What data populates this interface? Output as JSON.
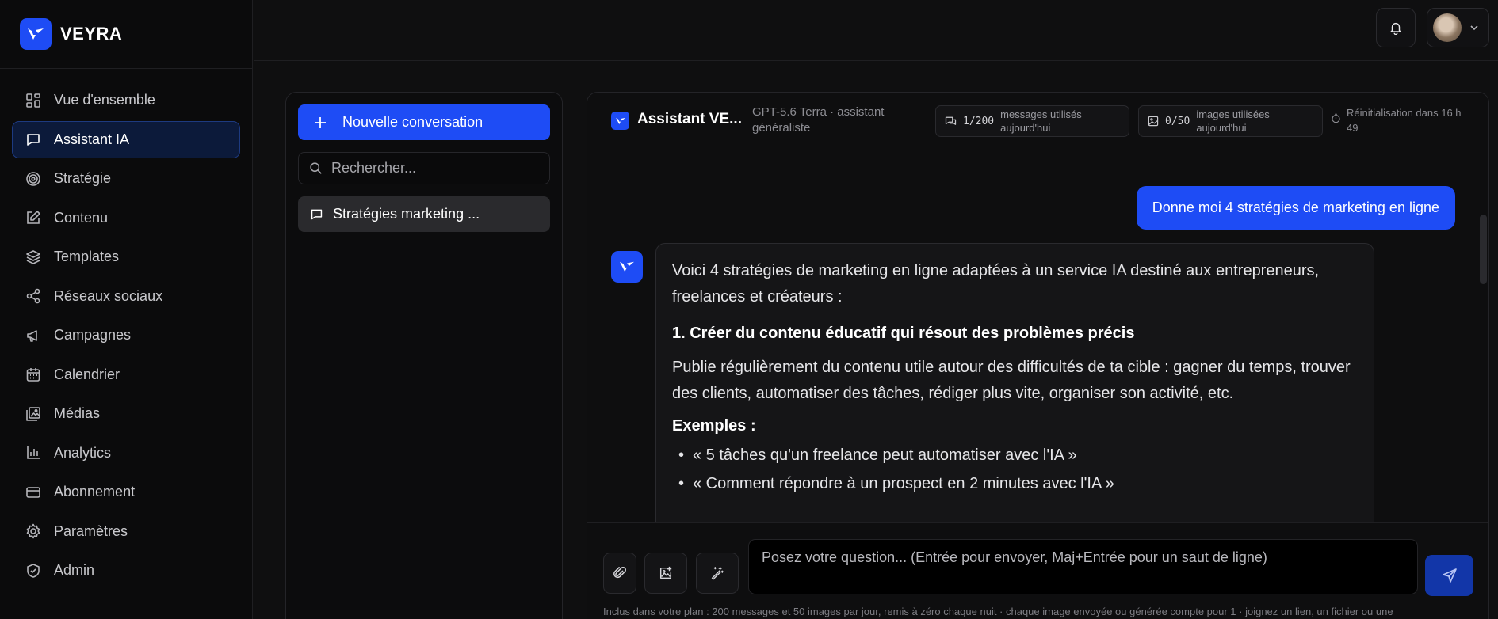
{
  "brand": {
    "name": "VEYRA"
  },
  "sidebar": {
    "items": [
      {
        "label": "Vue d'ensemble",
        "icon": "grid-icon",
        "active": false
      },
      {
        "label": "Assistant IA",
        "icon": "chat-icon",
        "active": true
      },
      {
        "label": "Stratégie",
        "icon": "target-icon",
        "active": false
      },
      {
        "label": "Contenu",
        "icon": "edit-icon",
        "active": false
      },
      {
        "label": "Templates",
        "icon": "layers-icon",
        "active": false
      },
      {
        "label": "Réseaux sociaux",
        "icon": "share-icon",
        "active": false
      },
      {
        "label": "Campagnes",
        "icon": "megaphone-icon",
        "active": false
      },
      {
        "label": "Calendrier",
        "icon": "calendar-icon",
        "active": false
      },
      {
        "label": "Médias",
        "icon": "images-icon",
        "active": false
      },
      {
        "label": "Analytics",
        "icon": "bar-chart-icon",
        "active": false
      },
      {
        "label": "Abonnement",
        "icon": "credit-card-icon",
        "active": false
      },
      {
        "label": "Paramètres",
        "icon": "gear-icon",
        "active": false
      },
      {
        "label": "Admin",
        "icon": "shield-icon",
        "active": false
      }
    ]
  },
  "conversations": {
    "new_label": "Nouvelle conversation",
    "search_placeholder": "Rechercher...",
    "items": [
      {
        "title": "Stratégies marketing ..."
      }
    ]
  },
  "chat": {
    "title": "Assistant VE...",
    "model": "GPT-5.6 Terra · assistant généraliste",
    "messages_usage": {
      "count": "1/200",
      "label": "messages utilisés aujourd'hui"
    },
    "images_usage": {
      "count": "0/50",
      "label": "images utilisées aujourd'hui"
    },
    "reset_text": "Réinitialisation dans 16 h 49",
    "user_message": "Donne moi 4 stratégies de marketing en ligne",
    "assistant": {
      "intro": "Voici 4 stratégies de marketing en ligne adaptées à un service IA destiné aux entrepreneurs, freelances et créateurs :",
      "heading1": "1. Créer du contenu éducatif qui résout des problèmes précis",
      "para1": "Publie régulièrement du contenu utile autour des difficultés de ta cible : gagner du temps, trouver des clients, automatiser des tâches, rédiger plus vite, organiser son activité, etc.",
      "examples_title": "Exemples :",
      "examples": [
        "« 5 tâches qu'un freelance peut automatiser avec l'IA »",
        "« Comment répondre à un prospect en 2 minutes avec l'IA »"
      ]
    },
    "composer": {
      "placeholder": "Posez votre question... (Entrée pour envoyer, Maj+Entrée pour un saut de ligne)",
      "plan_note": "Inclus dans votre plan : 200 messages et 50 images par jour, remis à zéro chaque nuit · chaque image envoyée ou générée compte pour 1 · joignez un lien, un fichier ou une"
    }
  },
  "colors": {
    "accent": "#1e4cf5",
    "background": "#0f0f10",
    "sidebar_active": "#0c1a3a"
  }
}
